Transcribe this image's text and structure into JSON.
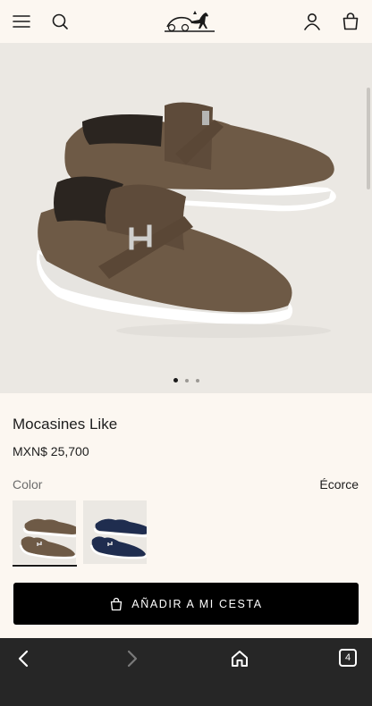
{
  "header": {
    "icons": [
      "menu-icon",
      "search-icon",
      "account-icon",
      "bag-icon"
    ],
    "logo": "hermes-carriage-logo"
  },
  "gallery": {
    "slides": 3,
    "active_slide": 1
  },
  "product": {
    "title": "Mocasines Like",
    "price": "MXN$ 25,700",
    "color_label": "Color",
    "color_value": "Écorce",
    "swatches": [
      "brown",
      "navy"
    ],
    "selected_swatch": 0
  },
  "cart": {
    "button_label": "AÑADIR A MI CESTA",
    "icon": "bag-icon"
  },
  "browser": {
    "tab_count": "4",
    "icons": [
      "back-icon",
      "forward-icon",
      "home-icon",
      "tabs-icon"
    ]
  },
  "colors": {
    "background": "#fcf7f1",
    "hero_background": "#ebe8e3",
    "button": "#000000",
    "browser_bar": "#262626",
    "brown_suede": "#6e5a46",
    "navy_suede": "#1f2d4f"
  }
}
